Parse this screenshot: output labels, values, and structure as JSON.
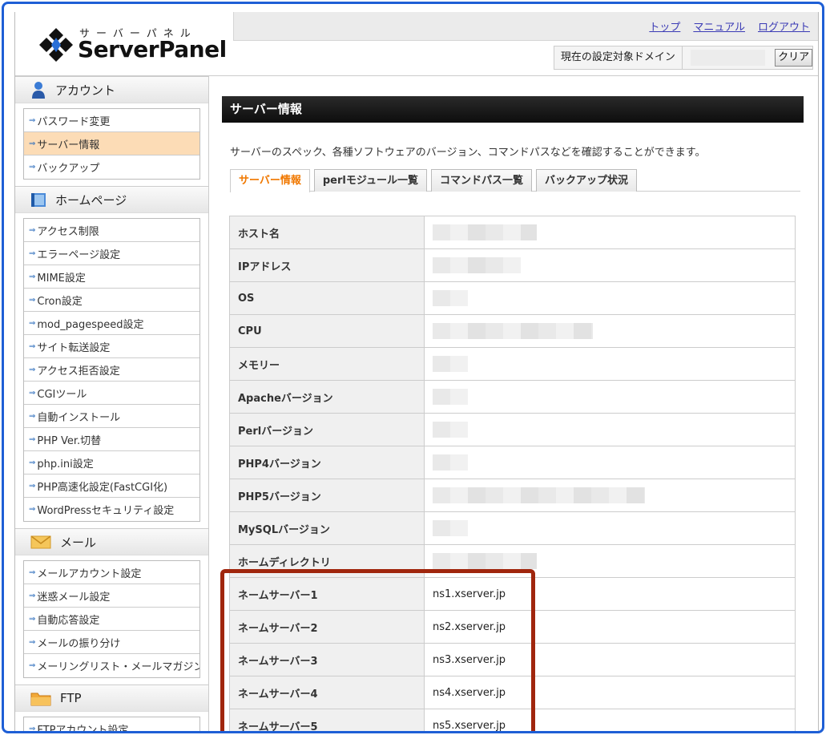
{
  "header": {
    "logo_kana": "サーバーパネル",
    "logo_name": "ServerPanel",
    "links": [
      "トップ",
      "マニュアル",
      "ログアウト"
    ],
    "domain_label": "現在の設定対象ドメイン",
    "clear_label": "クリア"
  },
  "sidebar": {
    "account": {
      "title": "アカウント",
      "items": [
        "パスワード変更",
        "サーバー情報",
        "バックアップ"
      ]
    },
    "homepage": {
      "title": "ホームページ",
      "items": [
        "アクセス制限",
        "エラーページ設定",
        "MIME設定",
        "Cron設定",
        "mod_pagespeed設定",
        "サイト転送設定",
        "アクセス拒否設定",
        "CGIツール",
        "自動インストール",
        "PHP Ver.切替",
        "php.ini設定",
        "PHP高速化設定(FastCGI化)",
        "WordPressセキュリティ設定"
      ]
    },
    "mail": {
      "title": "メール",
      "items": [
        "メールアカウント設定",
        "迷惑メール設定",
        "自動応答設定",
        "メールの振り分け",
        "メーリングリスト・メールマガジン"
      ]
    },
    "ftp": {
      "title": "FTP",
      "items": [
        "FTPアカウント設定"
      ]
    }
  },
  "main": {
    "title": "サーバー情報",
    "description": "サーバーのスペック、各種ソフトウェアのバージョン、コマンドパスなどを確認することができます。",
    "tabs": [
      "サーバー情報",
      "perlモジュール一覧",
      "コマンドパス一覧",
      "バックアップ状況"
    ],
    "rows": [
      {
        "label": "ホスト名",
        "value": ""
      },
      {
        "label": "IPアドレス",
        "value": ""
      },
      {
        "label": "OS",
        "value": ""
      },
      {
        "label": "CPU",
        "value": ""
      },
      {
        "label": "メモリー",
        "value": ""
      },
      {
        "label": "Apacheバージョン",
        "value": ""
      },
      {
        "label": "Perlバージョン",
        "value": ""
      },
      {
        "label": "PHP4バージョン",
        "value": ""
      },
      {
        "label": "PHP5バージョン",
        "value": ""
      },
      {
        "label": "MySQLバージョン",
        "value": ""
      },
      {
        "label": "ホームディレクトリ",
        "value": ""
      },
      {
        "label": "ネームサーバー1",
        "value": "ns1.xserver.jp"
      },
      {
        "label": "ネームサーバー2",
        "value": "ns2.xserver.jp"
      },
      {
        "label": "ネームサーバー3",
        "value": "ns3.xserver.jp"
      },
      {
        "label": "ネームサーバー4",
        "value": "ns4.xserver.jp"
      },
      {
        "label": "ネームサーバー5",
        "value": "ns5.xserver.jp"
      }
    ]
  },
  "colors": {
    "accent_tab": "#f07800",
    "highlight": "#a0260d",
    "active_sidebar": "#fcdcb6",
    "frame": "#1e5fd6"
  },
  "icons": {
    "account": "user-icon",
    "homepage": "book-icon",
    "mail": "envelope-icon",
    "ftp": "folder-icon"
  }
}
